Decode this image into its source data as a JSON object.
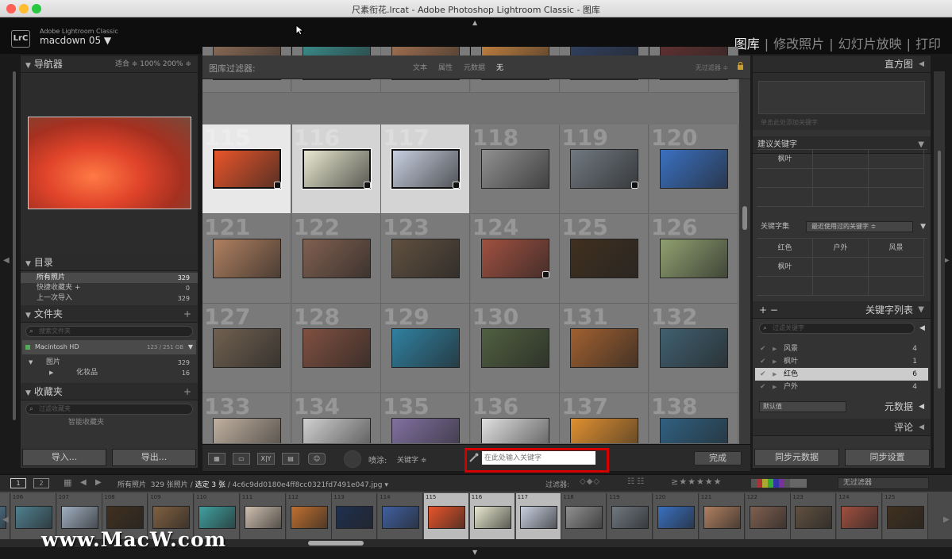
{
  "window": {
    "title": "尺素衔花.lrcat - Adobe Photoshop Lightroom Classic - 图库"
  },
  "header": {
    "app_name": "Adobe Lightroom Classic",
    "catalog": "macdown 05 ▼",
    "logo": "LrC",
    "modules": [
      {
        "label": "图库",
        "active": true
      },
      {
        "label": "|"
      },
      {
        "label": "修改照片"
      },
      {
        "label": "|"
      },
      {
        "label": "幻灯片放映"
      },
      {
        "label": "|"
      },
      {
        "label": "打印"
      }
    ]
  },
  "navigator": {
    "title": "导航器",
    "options": "适合 ≑   100%   200% ≑"
  },
  "catalog": {
    "title": "目录",
    "items": [
      {
        "label": "所有照片",
        "count": "329"
      },
      {
        "label": "快捷收藏夹 +",
        "count": "0"
      },
      {
        "label": "上一次导入",
        "count": "329"
      }
    ]
  },
  "folders": {
    "title": "文件夹",
    "search_placeholder": "搜索文件夹",
    "volume": "Macintosh HD",
    "volume_size": "123 / 251 GB",
    "items": [
      {
        "label": "图片",
        "count": "329"
      },
      {
        "label": "化妆品",
        "count": "16"
      }
    ]
  },
  "collections": {
    "title": "收藏夹",
    "search_placeholder": "过滤收藏夹",
    "smart": "智能收藏夹"
  },
  "left_buttons": {
    "import": "导入...",
    "export": "导出..."
  },
  "filter": {
    "label": "图库过滤器:",
    "tabs": [
      "文本",
      "属性",
      "元数据",
      "无"
    ],
    "preset": "无过滤器 ≑"
  },
  "grid": [
    {
      "n": "",
      "c": "#8a6a55"
    },
    {
      "n": "",
      "c": "#3a8c8a"
    },
    {
      "n": "",
      "c": "#a07050"
    },
    {
      "n": "",
      "c": "#c08040"
    },
    {
      "n": "",
      "c": "#304060"
    },
    {
      "n": "",
      "c": "#603030"
    },
    {
      "n": "115",
      "c": "#e8552a",
      "sel": true
    },
    {
      "n": "116",
      "c": "#e8e8d0",
      "sel": true
    },
    {
      "n": "117",
      "c": "#c8d0e0",
      "sel": true
    },
    {
      "n": "118",
      "c": "#909090"
    },
    {
      "n": "119",
      "c": "#707880"
    },
    {
      "n": "120",
      "c": "#3a70c0"
    },
    {
      "n": "121",
      "c": "#b08060"
    },
    {
      "n": "122",
      "c": "#806050"
    },
    {
      "n": "123",
      "c": "#605040"
    },
    {
      "n": "124",
      "c": "#a05040"
    },
    {
      "n": "125",
      "c": "#403020"
    },
    {
      "n": "126",
      "c": "#90a070"
    },
    {
      "n": "127",
      "c": "#706050"
    },
    {
      "n": "128",
      "c": "#805040"
    },
    {
      "n": "129",
      "c": "#3080a0"
    },
    {
      "n": "130",
      "c": "#506040"
    },
    {
      "n": "131",
      "c": "#a06030"
    },
    {
      "n": "132",
      "c": "#406070"
    },
    {
      "n": "133",
      "c": "#c0b0a0"
    },
    {
      "n": "134",
      "c": "#d0d0d0"
    },
    {
      "n": "135",
      "c": "#8070a0"
    },
    {
      "n": "136",
      "c": "#e0e0e0"
    },
    {
      "n": "137",
      "c": "#e09030"
    },
    {
      "n": "138",
      "c": "#306080"
    }
  ],
  "toolbar": {
    "spray_label": "喷涂:",
    "spray_mode": "关键字 ≑",
    "kw_placeholder": "在此处输入关键字",
    "done": "完成",
    "view_loupe": "X|Y"
  },
  "histogram": {
    "title": "直方图"
  },
  "keyword_suggest": {
    "placeholder": "单击此处添加关键字",
    "title": "建议关键字",
    "cell": "枫叶"
  },
  "keyword_set": {
    "label": "关键字集",
    "value": "最近使用过的关键字 ≑",
    "cells": [
      "红色",
      "户外",
      "风景",
      "枫叶"
    ]
  },
  "keyword_list": {
    "title": "关键字列表",
    "plusminus": "+  −",
    "search_placeholder": "过滤关键字",
    "items": [
      {
        "label": "风景",
        "count": "4"
      },
      {
        "label": "枫叶",
        "count": "1"
      },
      {
        "label": "红色",
        "count": "6",
        "on": true
      },
      {
        "label": "户外",
        "count": "4"
      }
    ]
  },
  "metadata": {
    "title": "元数据",
    "preset": "默认值"
  },
  "comments": {
    "title": "评论"
  },
  "right_buttons": {
    "sync_meta": "同步元数据",
    "sync_settings": "同步设置"
  },
  "filmbar": {
    "page1": "1",
    "page2": "2",
    "source": "所有照片",
    "info": "329 张照片 / ",
    "selected": "选定 3 张",
    "file": "/ 4c6c9dd0180e4ff8cc0321fd7491e047.jpg ▾",
    "filter_label": "过滤器:",
    "filter_preset": "无过滤器"
  },
  "filmstrip": [
    {
      "n": "",
      "c": "#6090b0"
    },
    {
      "n": "106",
      "c": "#508090"
    },
    {
      "n": "107",
      "c": "#a0b0c0"
    },
    {
      "n": "108",
      "c": "#403020"
    },
    {
      "n": "109",
      "c": "#806040"
    },
    {
      "n": "110",
      "c": "#40a0a0"
    },
    {
      "n": "111",
      "c": "#d0c0b0"
    },
    {
      "n": "112",
      "c": "#c07030"
    },
    {
      "n": "113",
      "c": "#203050"
    },
    {
      "n": "114",
      "c": "#4060a0"
    },
    {
      "n": "115",
      "c": "#e8552a",
      "sel": true
    },
    {
      "n": "116",
      "c": "#e8e8d0",
      "sel": true
    },
    {
      "n": "117",
      "c": "#c8d0e0",
      "sel": true
    },
    {
      "n": "118",
      "c": "#909090"
    },
    {
      "n": "119",
      "c": "#707880"
    },
    {
      "n": "120",
      "c": "#3a70c0"
    },
    {
      "n": "121",
      "c": "#b08060"
    },
    {
      "n": "122",
      "c": "#806050"
    },
    {
      "n": "123",
      "c": "#605040"
    },
    {
      "n": "124",
      "c": "#a05040"
    },
    {
      "n": "125",
      "c": "#403020"
    }
  ],
  "watermark": "www.MacW.com",
  "accent": "#d40000"
}
